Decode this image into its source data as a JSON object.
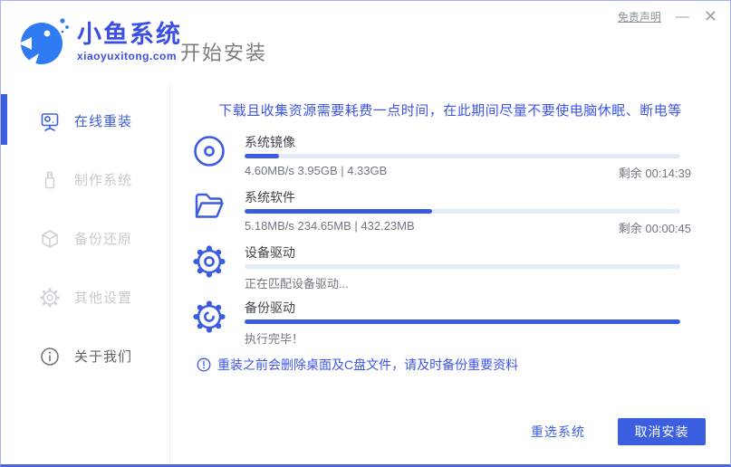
{
  "window": {
    "logo_name": "小鱼系统",
    "logo_sub": "xiaoyuxitong.com",
    "page_title": "开始安装",
    "disclaimer": "免责声明",
    "minimize_glyph": "—",
    "close_glyph": "✕"
  },
  "colors": {
    "accent_blue": "#3c5fe1",
    "logo_blue": "#2e7bf3",
    "notice_blue": "#3d55e8",
    "track_gray": "#e4ebf6",
    "disabled_gray": "#c6c9d2"
  },
  "sidebar": {
    "items": [
      {
        "label": "在线重装",
        "icon": "online-reinstall-icon",
        "state": "active"
      },
      {
        "label": "制作系统",
        "icon": "make-system-icon",
        "state": "dim"
      },
      {
        "label": "备份还原",
        "icon": "backup-restore-icon",
        "state": "dim"
      },
      {
        "label": "其他设置",
        "icon": "settings-icon",
        "state": "dim"
      },
      {
        "label": "关于我们",
        "icon": "about-icon",
        "state": "normal"
      }
    ]
  },
  "main": {
    "notice": "下载且收集资源需要耗费一点时间，在此期间尽量不要使电脑休眠、断电等",
    "tasks": [
      {
        "name": "系统镜像",
        "icon": "disc-icon",
        "progress": "8%",
        "status_left": "4.60MB/s 3.95GB | 4.33GB",
        "status_right": "剩余 00:14:39"
      },
      {
        "name": "系统软件",
        "icon": "folder-icon",
        "progress": "43%",
        "status_left": "5.18MB/s 234.65MB | 432.23MB",
        "status_right": "剩余 00:00:45"
      },
      {
        "name": "设备驱动",
        "icon": "gear-icon",
        "progress": "0%",
        "status_left": "正在匹配设备驱动...",
        "status_right": ""
      },
      {
        "name": "备份驱动",
        "icon": "backup-gear-icon",
        "progress": "100%",
        "status_left": "执行完毕！",
        "status_right": ""
      }
    ],
    "note": "重装之前会删除桌面及C盘文件，请及时备份重要资料"
  },
  "footer": {
    "reselect_label": "重选系统",
    "cancel_label": "取消安装"
  }
}
